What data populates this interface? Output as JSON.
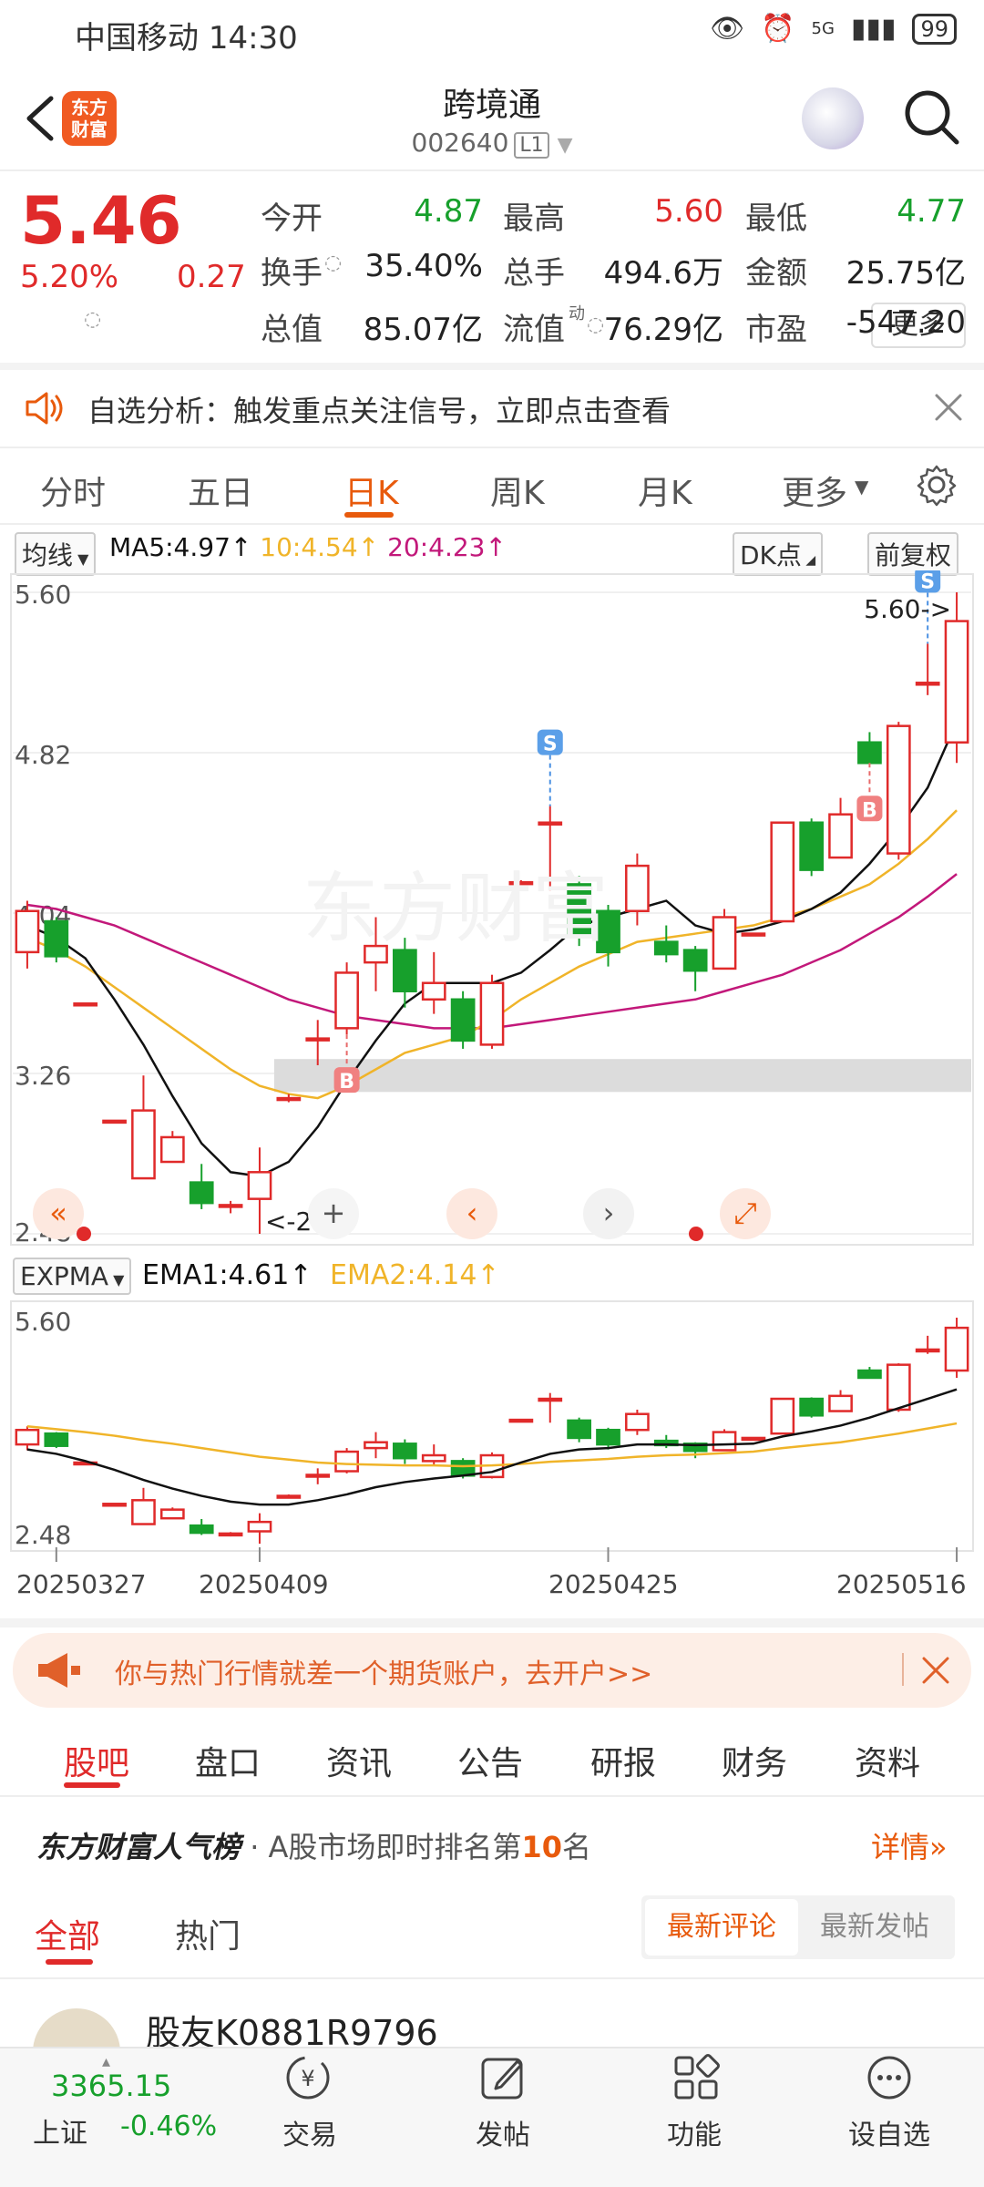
{
  "status": {
    "carrier": "中国移动",
    "time": "14:30",
    "battery": "99",
    "network": "5G"
  },
  "header": {
    "logo_text": "东方\n财富",
    "title": "跨境通",
    "code": "002640",
    "code_tag": "L1"
  },
  "quote": {
    "price": "5.46",
    "change_pct": "5.20%",
    "change": "0.27",
    "rows": [
      [
        {
          "label": "今开",
          "value": "4.87",
          "color": "green"
        },
        {
          "label": "最高",
          "value": "5.60",
          "color": "red"
        },
        {
          "label": "最低",
          "value": "4.77",
          "color": "green"
        }
      ],
      [
        {
          "label": "换手",
          "value": "35.40%",
          "color": ""
        },
        {
          "label": "总手",
          "value": "494.6万",
          "color": ""
        },
        {
          "label": "金额",
          "value": "25.75亿",
          "color": ""
        }
      ],
      [
        {
          "label": "总值",
          "value": "85.07亿",
          "color": ""
        },
        {
          "label": "流值",
          "value": "76.29亿",
          "color": ""
        },
        {
          "label": "市盈",
          "value": "-547.20",
          "color": ""
        }
      ]
    ],
    "pe_superscript": "动",
    "more_label": "更多"
  },
  "alert": {
    "text": "自选分析：触发重点关注信号，立即点击查看"
  },
  "chart_tabs": [
    "分时",
    "五日",
    "日K",
    "周K",
    "月K",
    "更多"
  ],
  "active_chart_tab": "日K",
  "ma_bar": {
    "selector": "均线",
    "ma5": "MA5:4.97↑",
    "ma10": "10:4.54↑",
    "ma20": "20:4.23↑",
    "dk_label": "DK点",
    "adjust_label": "前复权"
  },
  "expma_bar": {
    "selector": "EXPMA",
    "ema1": "EMA1:4.61↑",
    "ema2": "EMA2:4.14↑"
  },
  "colors": {
    "up": "#e02a2a",
    "down": "#17a02c",
    "ma5": "#111111",
    "ma10": "#f0b429",
    "ma20": "#c2187a",
    "accent": "#e85a0c"
  },
  "chart_data": {
    "type": "candlestick",
    "main": {
      "y_ticks": [
        "5.60",
        "4.82",
        "4.04",
        "3.26",
        "2.48"
      ],
      "ylim": [
        2.48,
        5.6
      ],
      "max_label": "5.60->",
      "min_label": "<-2.48",
      "candles": [
        {
          "o": 3.85,
          "c": 4.05,
          "h": 4.1,
          "l": 3.77
        },
        {
          "o": 4.0,
          "c": 3.83,
          "h": 4.02,
          "l": 3.8
        },
        {
          "o": 3.6,
          "c": 3.6,
          "h": 3.6,
          "l": 3.6
        },
        {
          "o": 3.03,
          "c": 3.03,
          "h": 3.03,
          "l": 3.03
        },
        {
          "o": 2.75,
          "c": 3.08,
          "h": 3.25,
          "l": 2.75
        },
        {
          "o": 2.83,
          "c": 2.95,
          "h": 2.98,
          "l": 2.83
        },
        {
          "o": 2.73,
          "c": 2.63,
          "h": 2.82,
          "l": 2.6
        },
        {
          "o": 2.62,
          "c": 2.62,
          "h": 2.64,
          "l": 2.58
        },
        {
          "o": 2.65,
          "c": 2.78,
          "h": 2.9,
          "l": 2.48
        },
        {
          "o": 3.14,
          "c": 3.14,
          "h": 3.16,
          "l": 3.12
        },
        {
          "o": 3.43,
          "c": 3.43,
          "h": 3.52,
          "l": 3.3
        },
        {
          "o": 3.48,
          "c": 3.75,
          "h": 3.8,
          "l": 3.45
        },
        {
          "o": 3.8,
          "c": 3.88,
          "h": 4.02,
          "l": 3.66
        },
        {
          "o": 3.86,
          "c": 3.66,
          "h": 3.92,
          "l": 3.58
        },
        {
          "o": 3.62,
          "c": 3.7,
          "h": 3.85,
          "l": 3.55
        },
        {
          "o": 3.62,
          "c": 3.42,
          "h": 3.66,
          "l": 3.38
        },
        {
          "o": 3.4,
          "c": 3.7,
          "h": 3.74,
          "l": 3.38
        },
        {
          "o": 4.19,
          "c": 4.19,
          "h": 4.2,
          "l": 4.18
        },
        {
          "o": 4.48,
          "c": 4.48,
          "h": 4.56,
          "l": 4.15
        },
        {
          "o": 4.18,
          "c": 3.94,
          "h": 4.22,
          "l": 3.88
        },
        {
          "o": 4.05,
          "c": 3.85,
          "h": 4.08,
          "l": 3.78
        },
        {
          "o": 4.05,
          "c": 4.27,
          "h": 4.33,
          "l": 3.98
        },
        {
          "o": 3.9,
          "c": 3.84,
          "h": 3.98,
          "l": 3.8
        },
        {
          "o": 3.86,
          "c": 3.76,
          "h": 3.88,
          "l": 3.66
        },
        {
          "o": 3.77,
          "c": 4.02,
          "h": 4.06,
          "l": 3.77
        },
        {
          "o": 3.94,
          "c": 3.94,
          "h": 3.94,
          "l": 3.94
        },
        {
          "o": 4.0,
          "c": 4.48,
          "h": 4.48,
          "l": 4.0
        },
        {
          "o": 4.48,
          "c": 4.25,
          "h": 4.5,
          "l": 4.22
        },
        {
          "o": 4.31,
          "c": 4.52,
          "h": 4.6,
          "l": 4.31
        },
        {
          "o": 4.87,
          "c": 4.77,
          "h": 4.92,
          "l": 4.77
        },
        {
          "o": 4.33,
          "c": 4.95,
          "h": 4.97,
          "l": 4.3
        },
        {
          "o": 5.16,
          "c": 5.16,
          "h": 5.35,
          "l": 5.1
        },
        {
          "o": 4.87,
          "c": 5.46,
          "h": 5.6,
          "l": 4.77
        }
      ],
      "ma5": [
        3.98,
        3.92,
        3.82,
        3.62,
        3.4,
        3.15,
        2.92,
        2.78,
        2.76,
        2.83,
        3.0,
        3.22,
        3.42,
        3.6,
        3.7,
        3.7,
        3.7,
        3.75,
        3.86,
        3.98,
        4.02,
        4.06,
        4.1,
        3.98,
        3.94,
        3.96,
        4.0,
        4.06,
        4.14,
        4.28,
        4.45,
        4.65,
        4.97
      ],
      "ma10": [
        3.92,
        3.86,
        3.78,
        3.68,
        3.58,
        3.48,
        3.38,
        3.28,
        3.2,
        3.16,
        3.14,
        3.2,
        3.28,
        3.36,
        3.4,
        3.44,
        3.52,
        3.62,
        3.7,
        3.78,
        3.84,
        3.9,
        3.92,
        3.94,
        3.96,
        3.98,
        4.02,
        4.06,
        4.12,
        4.18,
        4.28,
        4.4,
        4.54
      ],
      "ma20": [
        4.08,
        4.06,
        4.02,
        3.98,
        3.92,
        3.86,
        3.8,
        3.74,
        3.68,
        3.62,
        3.58,
        3.54,
        3.52,
        3.5,
        3.48,
        3.48,
        3.48,
        3.5,
        3.52,
        3.54,
        3.56,
        3.58,
        3.6,
        3.62,
        3.66,
        3.7,
        3.74,
        3.8,
        3.86,
        3.94,
        4.02,
        4.12,
        4.23
      ],
      "band": [
        3.17,
        3.33
      ],
      "signals": [
        {
          "type": "B",
          "index": 11
        },
        {
          "type": "S",
          "index": 18
        },
        {
          "type": "B",
          "index": 29
        },
        {
          "type": "S",
          "index": 31
        }
      ]
    },
    "expma": {
      "y_ticks": [
        "5.60",
        "2.48"
      ],
      "ylim": [
        2.48,
        5.6
      ],
      "ema1": [
        3.78,
        3.72,
        3.62,
        3.5,
        3.36,
        3.24,
        3.14,
        3.06,
        3.02,
        3.02,
        3.08,
        3.16,
        3.26,
        3.33,
        3.38,
        3.42,
        3.47,
        3.6,
        3.72,
        3.78,
        3.8,
        3.85,
        3.85,
        3.84,
        3.85,
        3.86,
        3.96,
        4.03,
        4.11,
        4.22,
        4.35,
        4.48,
        4.61
      ],
      "ema2": [
        4.1,
        4.06,
        4.02,
        3.97,
        3.91,
        3.86,
        3.8,
        3.74,
        3.68,
        3.64,
        3.6,
        3.58,
        3.57,
        3.56,
        3.56,
        3.55,
        3.56,
        3.58,
        3.61,
        3.63,
        3.65,
        3.68,
        3.7,
        3.71,
        3.73,
        3.75,
        3.8,
        3.84,
        3.88,
        3.94,
        4.0,
        4.07,
        4.14
      ]
    },
    "x_dates": [
      "20250327",
      "20250409",
      "20250425",
      "20250516"
    ]
  },
  "ad": {
    "text": "你与热门行情就差一个期货账户，去开户>>"
  },
  "sub_tabs": [
    "股吧",
    "盘口",
    "资讯",
    "公告",
    "研报",
    "财务",
    "资料"
  ],
  "rank": {
    "brand": "东方财富人气榜",
    "prefix": "· A股市场即时排名第",
    "number": "10",
    "suffix": "名",
    "detail": "详情»"
  },
  "feed_tabs": [
    "全部",
    "热门"
  ],
  "sort_tabs": [
    "最新评论",
    "最新发帖"
  ],
  "post": {
    "user": "股友K0881R9796"
  },
  "bottom_nav": {
    "index_value": "3365.15",
    "index_name": "上证",
    "index_change": "-0.46%",
    "items": [
      "交易",
      "发帖",
      "功能",
      "设自选"
    ]
  }
}
